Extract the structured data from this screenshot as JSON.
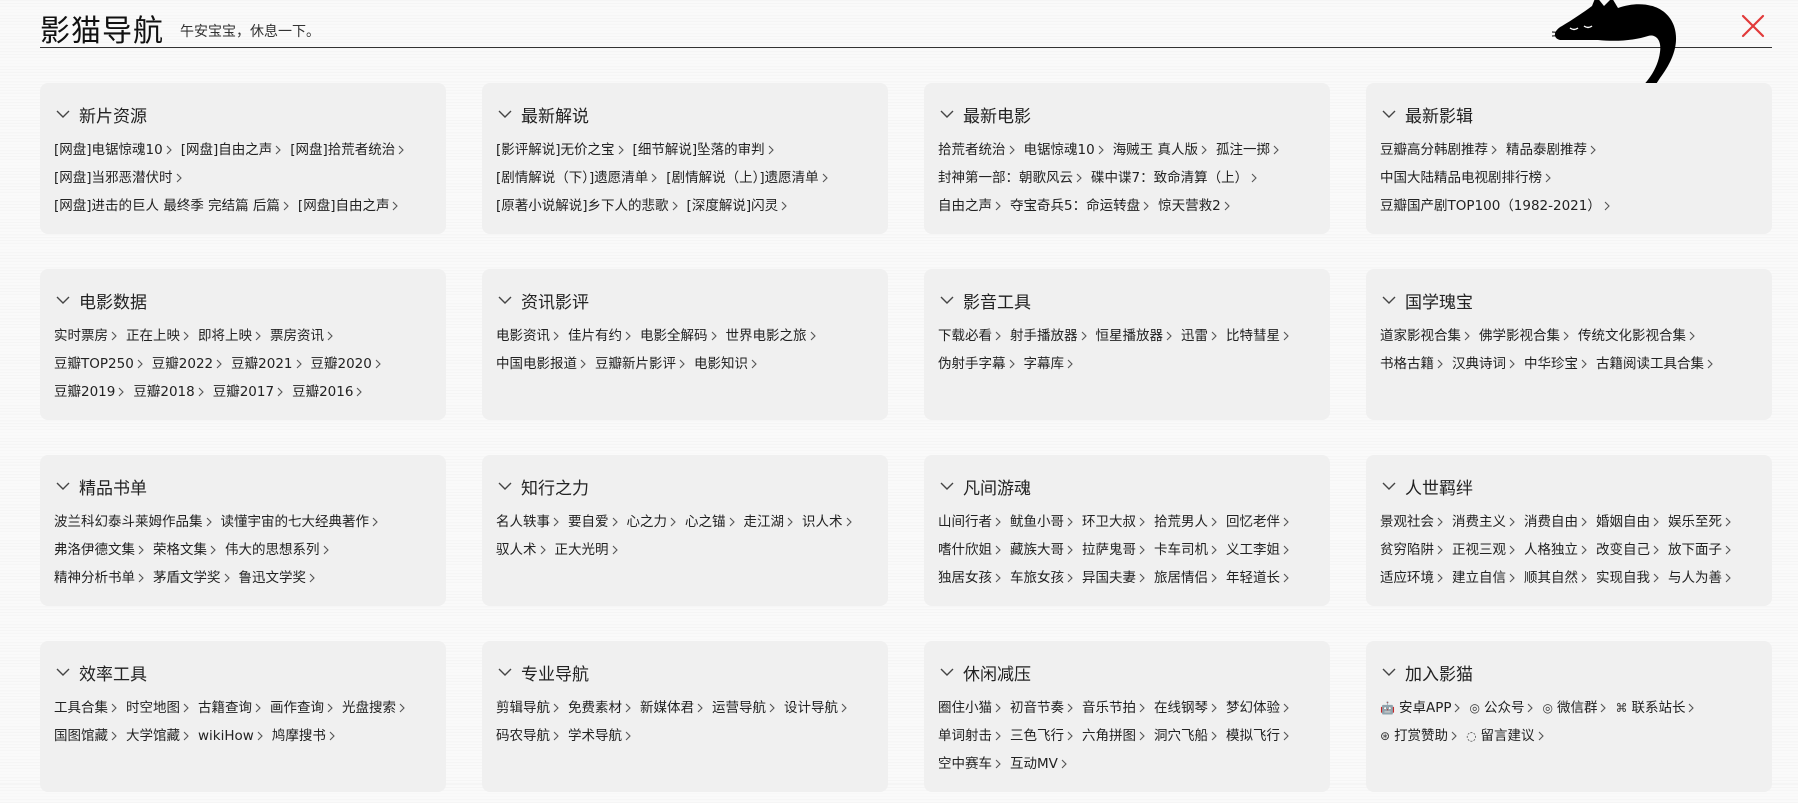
{
  "header": {
    "brand": "影猫导航",
    "greeting": "午安宝宝，休息一下。"
  },
  "sections": [
    {
      "title": "新片资源",
      "links": [
        {
          "text": "[网盘]电锯惊魂10"
        },
        {
          "text": "[网盘]自由之声"
        },
        {
          "text": "[网盘]拾荒者统治"
        },
        {
          "text": "[网盘]当邪恶潜伏时"
        },
        {
          "text": "[网盘]进击的巨人 最终季 完结篇 后篇"
        },
        {
          "text": "[网盘]自由之声"
        }
      ]
    },
    {
      "title": "最新解说",
      "links": [
        {
          "text": "[影评解说]无价之宝"
        },
        {
          "text": "[细节解说]坠落的审判"
        },
        {
          "text": "[剧情解说（下）]遗愿清单"
        },
        {
          "text": "[剧情解说（上）]遗愿清单"
        },
        {
          "text": "[原著小说解说]乡下人的悲歌"
        },
        {
          "text": "[深度解说]闪灵"
        }
      ]
    },
    {
      "title": "最新电影",
      "links": [
        {
          "text": "拾荒者统治"
        },
        {
          "text": "电锯惊魂10"
        },
        {
          "text": "海贼王 真人版"
        },
        {
          "text": "孤注一掷"
        },
        {
          "text": "封神第一部：朝歌风云"
        },
        {
          "text": "碟中谍7：致命清算（上）"
        },
        {
          "text": "自由之声"
        },
        {
          "text": "夺宝奇兵5：命运转盘"
        },
        {
          "text": "惊天营救2"
        }
      ]
    },
    {
      "title": "最新影辑",
      "links": [
        {
          "text": "豆瓣高分韩剧推荐"
        },
        {
          "text": "精品泰剧推荐"
        },
        {
          "text": "中国大陆精品电视剧排行榜"
        },
        {
          "text": "豆瓣国产剧TOP100（1982-2021）"
        }
      ]
    },
    {
      "title": "电影数据",
      "links": [
        {
          "text": "实时票房"
        },
        {
          "text": "正在上映"
        },
        {
          "text": "即将上映"
        },
        {
          "text": "票房资讯"
        },
        {
          "text": "豆瓣TOP250"
        },
        {
          "text": "豆瓣2022"
        },
        {
          "text": "豆瓣2021"
        },
        {
          "text": "豆瓣2020"
        },
        {
          "text": "豆瓣2019"
        },
        {
          "text": "豆瓣2018"
        },
        {
          "text": "豆瓣2017"
        },
        {
          "text": "豆瓣2016"
        }
      ]
    },
    {
      "title": "资讯影评",
      "links": [
        {
          "text": "电影资讯"
        },
        {
          "text": "佳片有约"
        },
        {
          "text": "电影全解码"
        },
        {
          "text": "世界电影之旅"
        },
        {
          "text": "中国电影报道"
        },
        {
          "text": "豆瓣新片影评"
        },
        {
          "text": "电影知识"
        }
      ]
    },
    {
      "title": "影音工具",
      "links": [
        {
          "text": "下载必看"
        },
        {
          "text": "射手播放器"
        },
        {
          "text": "恒星播放器"
        },
        {
          "text": "迅雷"
        },
        {
          "text": "比特彗星"
        },
        {
          "text": "伪射手字幕"
        },
        {
          "text": "字幕库"
        }
      ]
    },
    {
      "title": "国学瑰宝",
      "links": [
        {
          "text": "道家影视合集"
        },
        {
          "text": "佛学影视合集"
        },
        {
          "text": "传统文化影视合集"
        },
        {
          "text": "书格古籍"
        },
        {
          "text": "汉典诗词"
        },
        {
          "text": "中华珍宝"
        },
        {
          "text": "古籍阅读工具合集"
        }
      ]
    },
    {
      "title": "精品书单",
      "links": [
        {
          "text": "波兰科幻泰斗莱姆作品集"
        },
        {
          "text": "读懂宇宙的七大经典著作"
        },
        {
          "text": "弗洛伊德文集"
        },
        {
          "text": "荣格文集"
        },
        {
          "text": "伟大的思想系列"
        },
        {
          "text": "精神分析书单"
        },
        {
          "text": "茅盾文学奖"
        },
        {
          "text": "鲁迅文学奖"
        }
      ]
    },
    {
      "title": "知行之力",
      "links": [
        {
          "text": "名人轶事"
        },
        {
          "text": "要自爱"
        },
        {
          "text": "心之力"
        },
        {
          "text": "心之锚"
        },
        {
          "text": "走江湖"
        },
        {
          "text": "识人术"
        },
        {
          "text": "驭人术"
        },
        {
          "text": "正大光明"
        }
      ]
    },
    {
      "title": "凡间游魂",
      "links": [
        {
          "text": "山间行者"
        },
        {
          "text": "鱿鱼小哥"
        },
        {
          "text": "环卫大叔"
        },
        {
          "text": "拾荒男人"
        },
        {
          "text": "回忆老伴"
        },
        {
          "text": "嗜什欣姐"
        },
        {
          "text": "藏族大哥"
        },
        {
          "text": "拉萨鬼哥"
        },
        {
          "text": "卡车司机"
        },
        {
          "text": "义工李姐"
        },
        {
          "text": "独居女孩"
        },
        {
          "text": "车旅女孩"
        },
        {
          "text": "异国夫妻"
        },
        {
          "text": "旅居情侣"
        },
        {
          "text": "年轻道长"
        }
      ]
    },
    {
      "title": "人世羁绊",
      "links": [
        {
          "text": "景观社会"
        },
        {
          "text": "消费主义"
        },
        {
          "text": "消费自由"
        },
        {
          "text": "婚姻自由"
        },
        {
          "text": "娱乐至死"
        },
        {
          "text": "贫穷陷阱"
        },
        {
          "text": "正视三观"
        },
        {
          "text": "人格独立"
        },
        {
          "text": "改变自己"
        },
        {
          "text": "放下面子"
        },
        {
          "text": "适应环境"
        },
        {
          "text": "建立自信"
        },
        {
          "text": "顺其自然"
        },
        {
          "text": "实现自我"
        },
        {
          "text": "与人为善"
        }
      ]
    },
    {
      "title": "效率工具",
      "links": [
        {
          "text": "工具合集"
        },
        {
          "text": "时空地图"
        },
        {
          "text": "古籍查询"
        },
        {
          "text": "画作查询"
        },
        {
          "text": "光盘搜索"
        },
        {
          "text": "国图馆藏"
        },
        {
          "text": "大学馆藏"
        },
        {
          "text": "wikiHow"
        },
        {
          "text": "鸠摩搜书"
        }
      ]
    },
    {
      "title": "专业导航",
      "links": [
        {
          "text": "剪辑导航"
        },
        {
          "text": "免费素材"
        },
        {
          "text": "新媒体君"
        },
        {
          "text": "运营导航"
        },
        {
          "text": "设计导航"
        },
        {
          "text": "码农导航"
        },
        {
          "text": "学术导航"
        }
      ]
    },
    {
      "title": "休闲减压",
      "links": [
        {
          "text": "圈住小猫"
        },
        {
          "text": "初音节奏"
        },
        {
          "text": "音乐节拍"
        },
        {
          "text": "在线钢琴"
        },
        {
          "text": "梦幻体验"
        },
        {
          "text": "单词射击"
        },
        {
          "text": "三色飞行"
        },
        {
          "text": "六角拼图"
        },
        {
          "text": "洞穴飞船"
        },
        {
          "text": "模拟飞行"
        },
        {
          "text": "空中赛车"
        },
        {
          "text": "互动MV"
        }
      ]
    },
    {
      "title": "加入影猫",
      "links": [
        {
          "text": "安卓APP",
          "icon": "android-icon",
          "glyph": "🤖"
        },
        {
          "text": "公众号",
          "icon": "wechat-official-icon",
          "glyph": "◎"
        },
        {
          "text": "微信群",
          "icon": "wechat-group-icon",
          "glyph": "◎"
        },
        {
          "text": "联系站长",
          "icon": "gamepad-icon",
          "glyph": "⌘"
        },
        {
          "text": "打赏赞助",
          "icon": "coin-icon",
          "glyph": "⊛"
        },
        {
          "text": "留言建议",
          "icon": "comment-icon",
          "glyph": "◌"
        }
      ]
    }
  ]
}
